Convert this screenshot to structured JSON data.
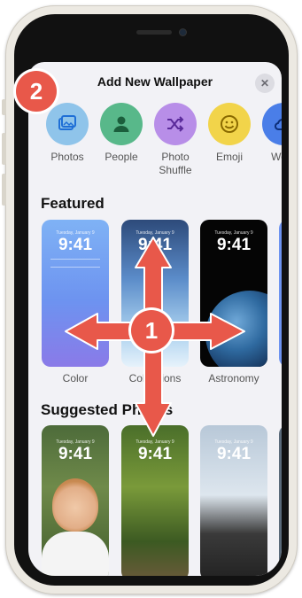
{
  "sheet": {
    "title": "Add New Wallpaper",
    "close_icon": "close-icon"
  },
  "categories": [
    {
      "label": "Photos",
      "icon": "photos-icon",
      "color": "#8fc4ea"
    },
    {
      "label": "People",
      "icon": "person-icon",
      "color": "#58b88a"
    },
    {
      "label": "Photo\nShuffle",
      "icon": "shuffle-icon",
      "color": "#b88ee8"
    },
    {
      "label": "Emoji",
      "icon": "emoji-icon",
      "color": "#f2d44a"
    },
    {
      "label": "Weat",
      "icon": "weather-icon",
      "color": "#4a7ee8"
    }
  ],
  "featured": {
    "title": "Featured",
    "cards": [
      {
        "caption": "Color",
        "date": "Tuesday, January 9",
        "time": "9:41"
      },
      {
        "caption": "Collections",
        "date": "Tuesday, January 9",
        "time": "9:41"
      },
      {
        "caption": "Astronomy",
        "date": "Tuesday, January 9",
        "time": "9:41"
      }
    ]
  },
  "suggested": {
    "title": "Suggested Photos",
    "cards": [
      {
        "date": "Tuesday, January 9",
        "time": "9:41"
      },
      {
        "date": "Tuesday, January 9",
        "time": "9:41"
      },
      {
        "date": "Tuesday, January 9",
        "time": "9:41"
      }
    ]
  },
  "annotations": {
    "badge_1": "1",
    "badge_2": "2",
    "arrow_color": "#e8584a"
  }
}
